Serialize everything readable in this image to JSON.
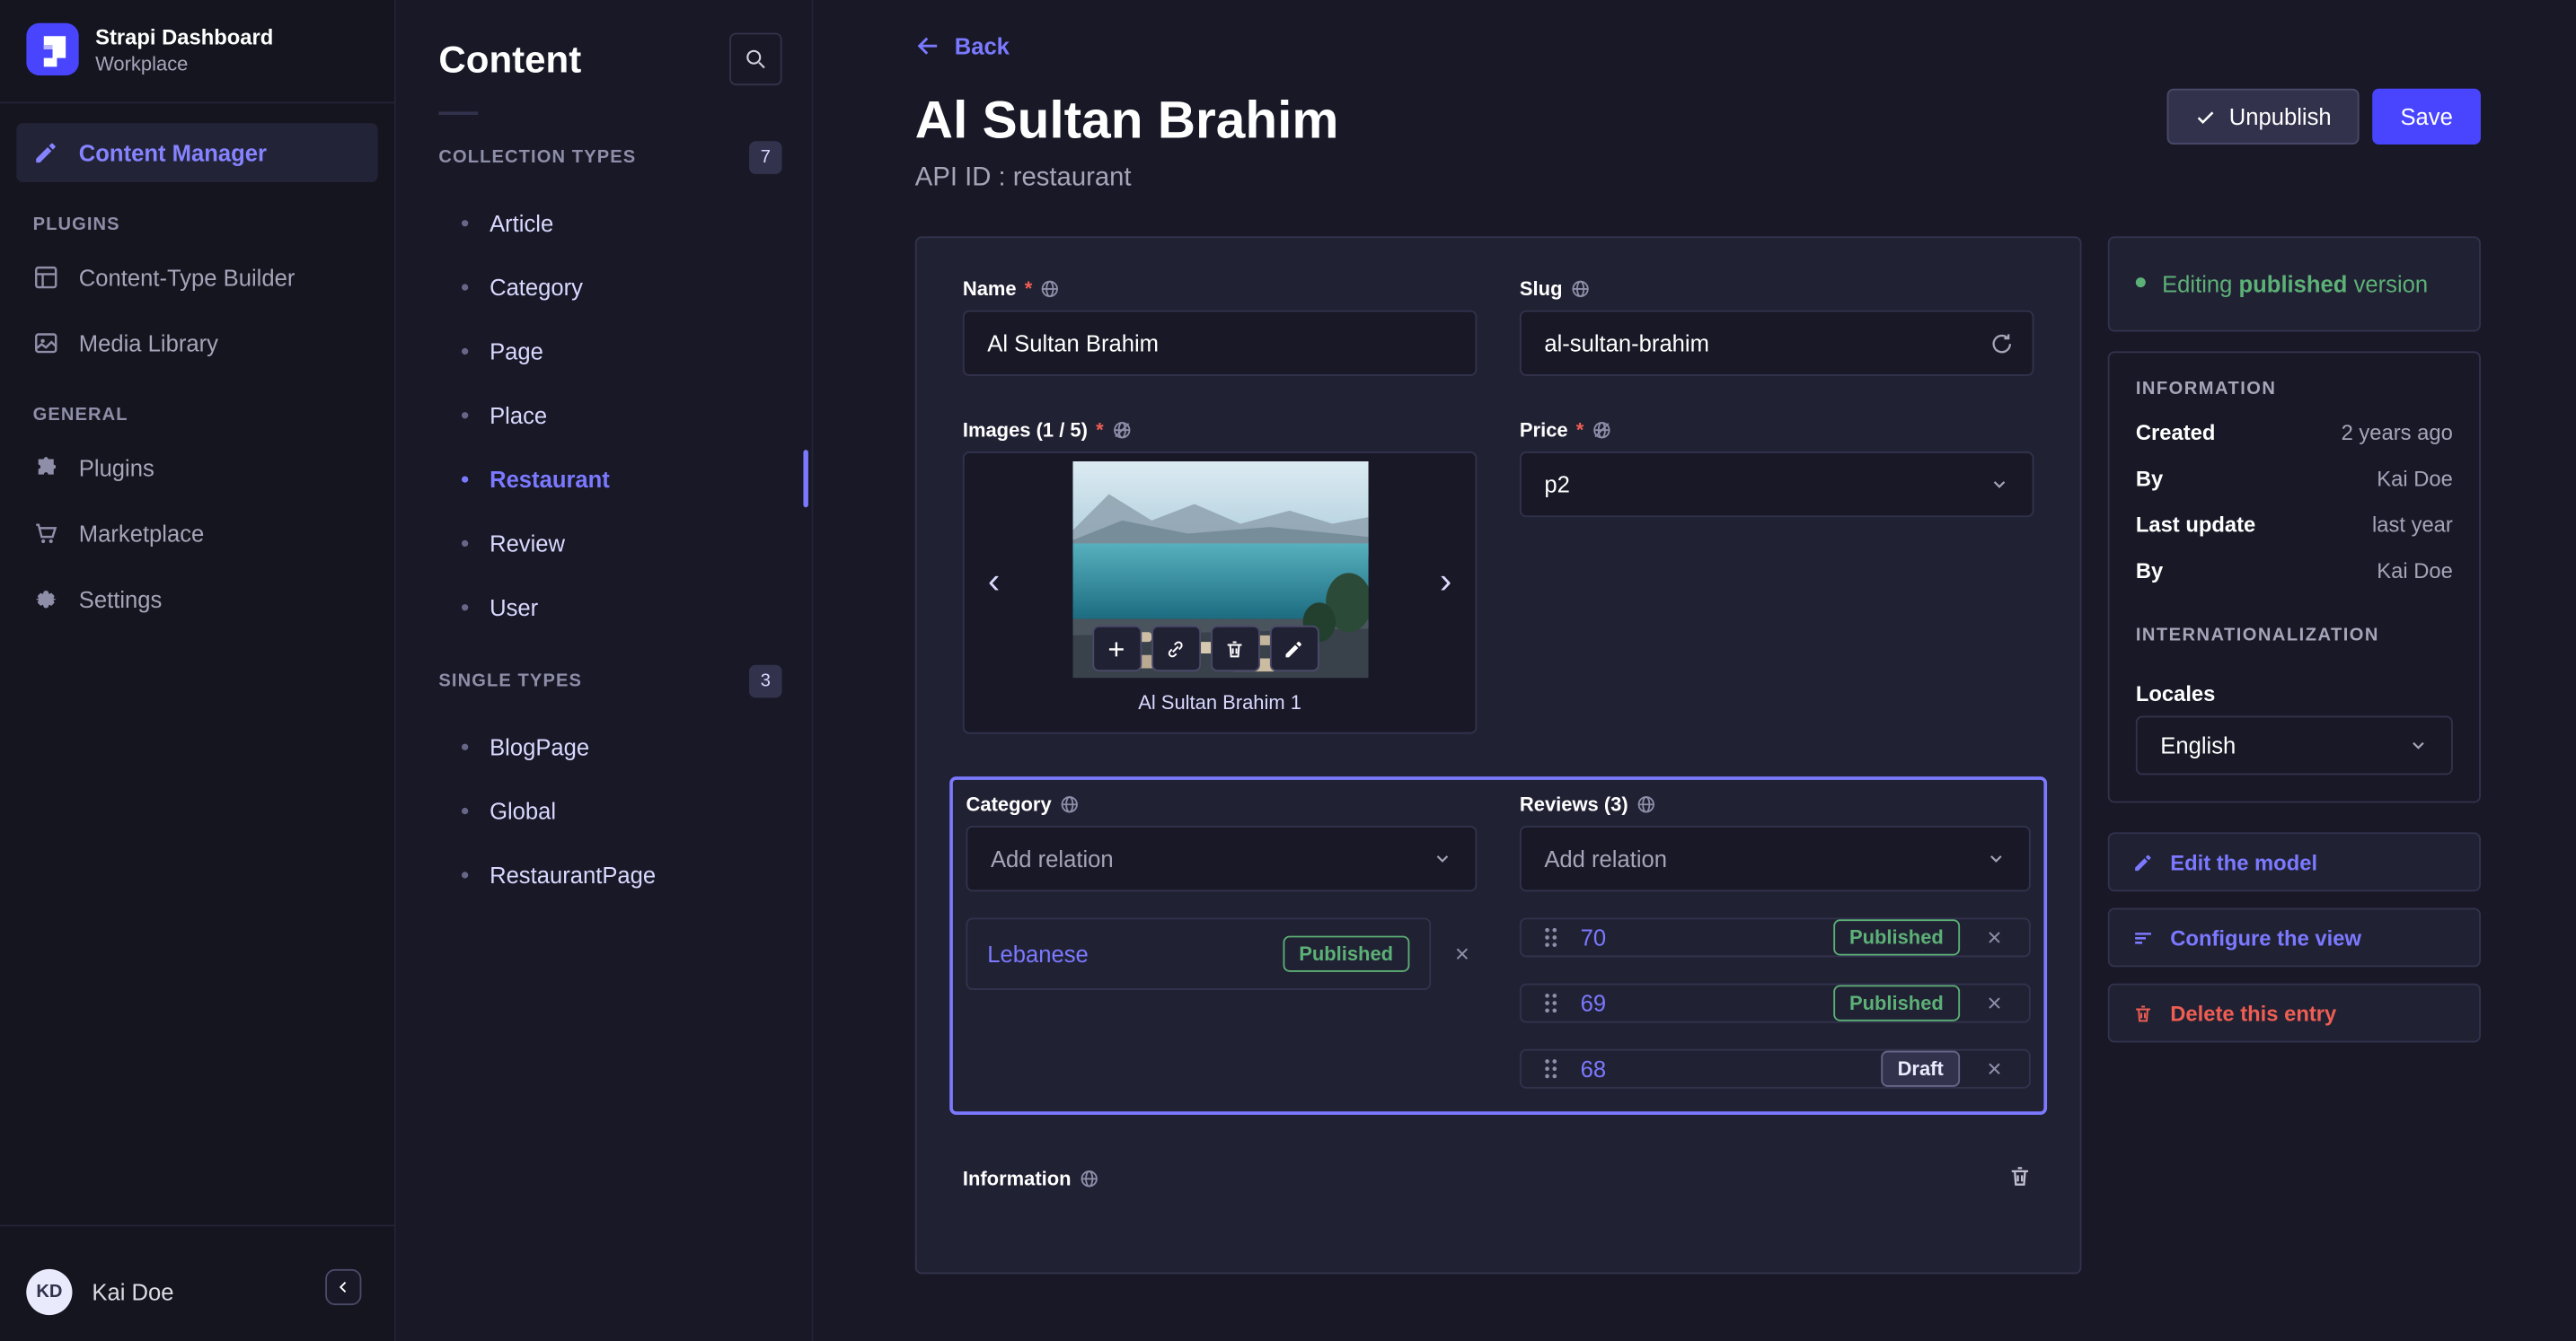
{
  "colors": {
    "primary": "#4945ff",
    "primary_light": "#7b79ff",
    "success": "#5cb176",
    "danger": "#ee5e52"
  },
  "required_mark": "*",
  "sidebar": {
    "brand_title": "Strapi Dashboard",
    "brand_subtitle": "Workplace",
    "content_manager_label": "Content Manager",
    "plugins_section_label": "PLUGINS",
    "plugins_items": [
      {
        "label": "Content-Type Builder",
        "icon": "content-type-builder-icon"
      },
      {
        "label": "Media Library",
        "icon": "media-library-icon"
      }
    ],
    "general_section_label": "GENERAL",
    "general_items": [
      {
        "label": "Plugins",
        "icon": "puzzle-icon"
      },
      {
        "label": "Marketplace",
        "icon": "cart-icon"
      },
      {
        "label": "Settings",
        "icon": "gear-icon"
      }
    ],
    "user_initials": "KD",
    "user_name": "Kai Doe"
  },
  "subnav": {
    "title": "Content",
    "collection_types_label": "COLLECTION TYPES",
    "collection_types_count": "7",
    "collection_items": [
      "Article",
      "Category",
      "Page",
      "Place",
      "Restaurant",
      "Review",
      "User"
    ],
    "single_types_label": "SINGLE TYPES",
    "single_types_count": "3",
    "single_items": [
      "BlogPage",
      "Global",
      "RestaurantPage"
    ]
  },
  "header": {
    "back_label": "Back",
    "title": "Al Sultan Brahim",
    "api_id": "API ID : restaurant",
    "unpublish_label": "Unpublish",
    "save_label": "Save"
  },
  "form": {
    "name_label": "Name",
    "name_value": "Al Sultan Brahim",
    "slug_label": "Slug",
    "slug_value": "al-sultan-brahim",
    "images_label": "Images (1 / 5)",
    "image_caption": "Al Sultan Brahim 1",
    "price_label": "Price",
    "price_value": "p2",
    "category_label": "Category",
    "category_placeholder": "Add relation",
    "category_relations": [
      {
        "name": "Lebanese",
        "status": "Published"
      }
    ],
    "reviews_label": "Reviews (3)",
    "reviews_placeholder": "Add relation",
    "review_relations": [
      {
        "name": "70",
        "status": "Published"
      },
      {
        "name": "69",
        "status": "Published"
      },
      {
        "name": "68",
        "status": "Draft"
      }
    ],
    "information_label": "Information"
  },
  "aside": {
    "editing_prefix": "Editing",
    "editing_bold": "published",
    "editing_suffix": "version",
    "information_label": "INFORMATION",
    "info_rows": [
      {
        "label": "Created",
        "value": "2 years ago"
      },
      {
        "label": "By",
        "value": "Kai Doe"
      },
      {
        "label": "Last update",
        "value": "last year"
      },
      {
        "label": "By",
        "value": "Kai Doe"
      }
    ],
    "i18n_label": "INTERNATIONALIZATION",
    "locales_label": "Locales",
    "locale_value": "English",
    "edit_model_label": "Edit the model",
    "configure_view_label": "Configure the view",
    "delete_entry_label": "Delete this entry"
  }
}
